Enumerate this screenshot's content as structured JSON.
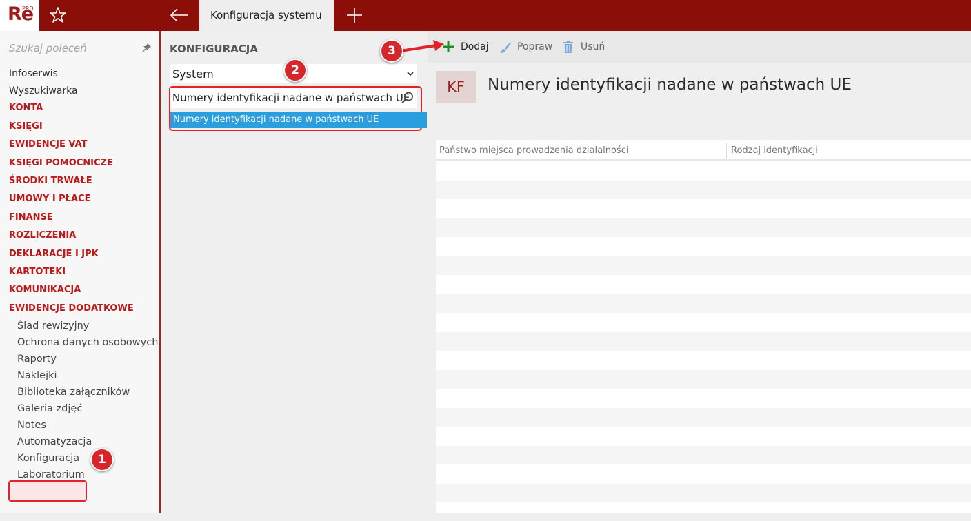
{
  "app": {
    "logo": "Re",
    "logo_sup": "PRO",
    "active_tab": "Konfiguracja systemu"
  },
  "sidebar": {
    "search_placeholder": "Szukaj poleceń",
    "items": [
      {
        "label": "Infoserwis",
        "kind": "plain"
      },
      {
        "label": "Wyszukiwarka",
        "kind": "plain"
      },
      {
        "label": "KONTA",
        "kind": "section"
      },
      {
        "label": "KSIĘGI",
        "kind": "section"
      },
      {
        "label": "EWIDENCJE VAT",
        "kind": "section"
      },
      {
        "label": "KSIĘGI POMOCNICZE",
        "kind": "section"
      },
      {
        "label": "ŚRODKI TRWAŁE",
        "kind": "section"
      },
      {
        "label": "UMOWY I PŁACE",
        "kind": "section"
      },
      {
        "label": "FINANSE",
        "kind": "section"
      },
      {
        "label": "ROZLICZENIA",
        "kind": "section"
      },
      {
        "label": "DEKLARACJE I JPK",
        "kind": "section"
      },
      {
        "label": "KARTOTEKI",
        "kind": "section"
      },
      {
        "label": "KOMUNIKACJA",
        "kind": "section"
      },
      {
        "label": "EWIDENCJE DODATKOWE",
        "kind": "section"
      },
      {
        "label": "Ślad rewizyjny",
        "kind": "sub"
      },
      {
        "label": "Ochrona danych osobowych",
        "kind": "sub"
      },
      {
        "label": "Raporty",
        "kind": "sub"
      },
      {
        "label": "Naklejki",
        "kind": "sub"
      },
      {
        "label": "Biblioteka załączników",
        "kind": "sub"
      },
      {
        "label": "Galeria zdjęć",
        "kind": "sub"
      },
      {
        "label": "Notes",
        "kind": "sub"
      },
      {
        "label": "Automatyzacja",
        "kind": "sub"
      },
      {
        "label": "Konfiguracja",
        "kind": "sub"
      },
      {
        "label": "Laboratorium",
        "kind": "sub"
      }
    ]
  },
  "badges": {
    "one": "1",
    "two": "2",
    "three": "3"
  },
  "config_panel": {
    "title": "KONFIGURACJA",
    "category": "System",
    "search_value": "Numery identyfikacji nadane w państwach UE",
    "result": "Numery identyfikacji nadane w państwach UE"
  },
  "toolbar": {
    "add": "Dodaj",
    "edit": "Popraw",
    "delete": "Usuń"
  },
  "content": {
    "tile": "KF",
    "title": "Numery identyfikacji nadane w państwach UE",
    "columns": [
      "Państwo miejsca prowadzenia działalności",
      "Rodzaj identyfikacji"
    ]
  },
  "colors": {
    "brand": "#8b0f08",
    "section_text": "#ba1a1a",
    "selection": "#2b9ee0",
    "annotation": "#d7262b"
  }
}
